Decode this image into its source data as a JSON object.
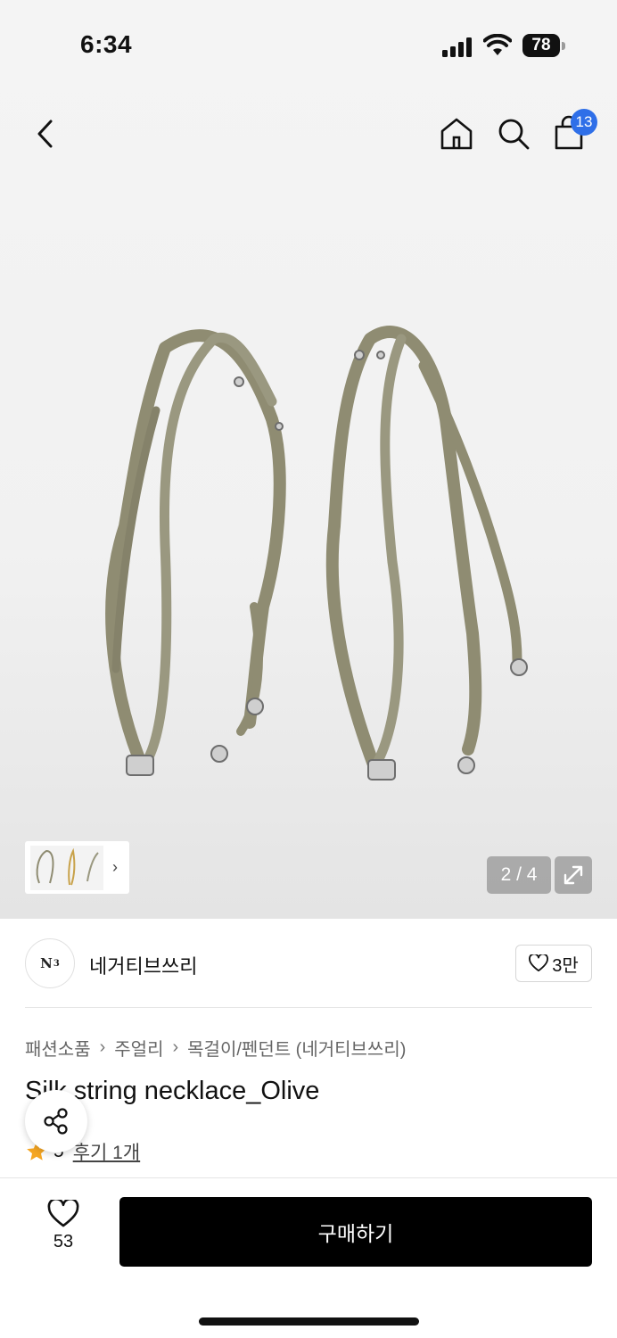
{
  "status_bar": {
    "time": "6:34",
    "battery": "78"
  },
  "nav": {
    "cart_count": "13"
  },
  "gallery": {
    "page_indicator": "2 / 4"
  },
  "brand": {
    "logo_text": "N",
    "name": "네거티브쓰리",
    "favorites": "3만"
  },
  "breadcrumb": [
    "패션소품",
    "주얼리",
    "목걸이/펜던트 (네거티브쓰리)"
  ],
  "product": {
    "title": "Silk string necklace_Olive",
    "rating": "5",
    "reviews": "후기 1개"
  },
  "bottom_bar": {
    "like_count": "53",
    "buy_label": "구매하기"
  },
  "colors": {
    "accent_badge": "#2f6fe8",
    "star": "#f5a623",
    "necklace": "#8f8c72"
  },
  "icons": [
    "back-icon",
    "home-icon",
    "search-icon",
    "cart-icon",
    "expand-icon",
    "heart-icon",
    "share-icon",
    "star-icon"
  ]
}
